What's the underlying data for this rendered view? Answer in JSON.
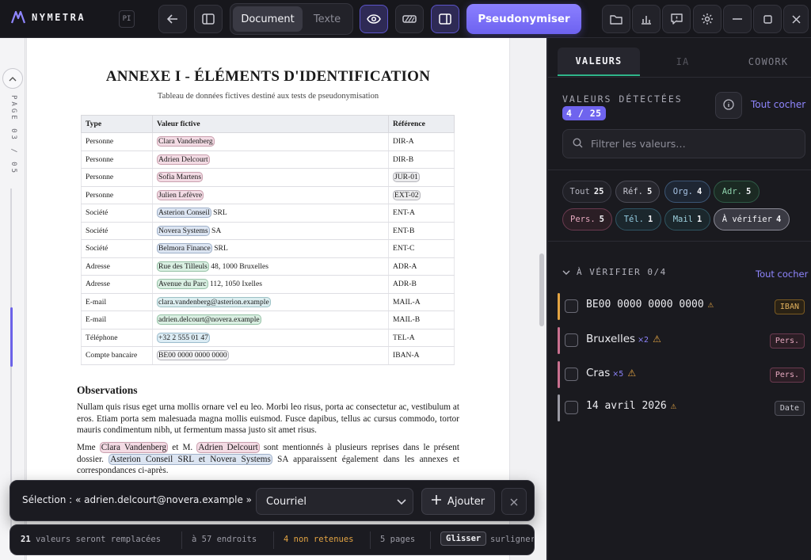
{
  "app": {
    "name": "NYMETRA",
    "page_badge": "PI"
  },
  "toolbar": {
    "view_tabs": [
      "Document",
      "Texte"
    ],
    "active_view": "Document",
    "pseudonymize_label": "Pseudonymiser"
  },
  "gutter": {
    "page_label": "PAGE 03 / 05"
  },
  "document": {
    "title": "ANNEXE I - ÉLÉMENTS D'IDENTIFICATION",
    "subtitle": "Tableau de données fictives destiné aux tests de pseudonymisation",
    "columns": [
      "Type",
      "Valeur fictive",
      "Référence"
    ],
    "rows": [
      {
        "type": "Personne",
        "value": "Clara Vandenberg",
        "suffix": "",
        "value_kind": "pers",
        "ref": "DIR-A",
        "ref_kind": ""
      },
      {
        "type": "Personne",
        "value": "Adrien Delcourt",
        "suffix": "",
        "value_kind": "pers",
        "ref": "DIR-B",
        "ref_kind": ""
      },
      {
        "type": "Personne",
        "value": "Sofia Martens",
        "suffix": "",
        "value_kind": "pers",
        "ref": "JUR-01",
        "ref_kind": "ref"
      },
      {
        "type": "Personne",
        "value": "Julien Lefèvre",
        "suffix": "",
        "value_kind": "pers",
        "ref": "EXT-02",
        "ref_kind": "ref"
      },
      {
        "type": "Société",
        "value": "Asterion Conseil",
        "suffix": " SRL",
        "value_kind": "org",
        "ref": "ENT-A",
        "ref_kind": ""
      },
      {
        "type": "Société",
        "value": "Novera Systems",
        "suffix": " SA",
        "value_kind": "org",
        "ref": "ENT-B",
        "ref_kind": ""
      },
      {
        "type": "Société",
        "value": "Belmora Finance",
        "suffix": " SRL",
        "value_kind": "org",
        "ref": "ENT-C",
        "ref_kind": ""
      },
      {
        "type": "Adresse",
        "value": "Rue des Tilleuls",
        "suffix": " 48, 1000 Bruxelles",
        "value_kind": "adr",
        "ref": "ADR-A",
        "ref_kind": ""
      },
      {
        "type": "Adresse",
        "value": "Avenue du Parc",
        "suffix": " 112, 1050 Ixelles",
        "value_kind": "adr",
        "ref": "ADR-B",
        "ref_kind": ""
      },
      {
        "type": "E-mail",
        "value": "clara.vandenberg@asterion.example",
        "suffix": "",
        "value_kind": "mail",
        "ref": "MAIL-A",
        "ref_kind": ""
      },
      {
        "type": "E-mail",
        "value": "adrien.delcourt@novera.example",
        "suffix": "",
        "value_kind": "adr",
        "ref": "MAIL-B",
        "ref_kind": ""
      },
      {
        "type": "Téléphone",
        "value": "+32 2 555 01 47",
        "suffix": "",
        "value_kind": "tel",
        "ref": "TEL-A",
        "ref_kind": ""
      },
      {
        "type": "Compte bancaire",
        "value": "BE00 0000 0000 0000",
        "suffix": "",
        "value_kind": "iban",
        "ref": "IBAN-A",
        "ref_kind": ""
      }
    ],
    "observations_title": "Observations",
    "para1": "Nullam quis risus eget urna mollis ornare vel eu leo. Morbi leo risus, porta ac consectetur ac, vestibulum at eros. Etiam porta sem malesuada magna mollis euismod. Fusce dapibus, tellus ac cursus commodo, tortor mauris condimentum nibh, ut fermentum massa justo sit amet risus.",
    "para2": {
      "t1": "Mme ",
      "h1": "Clara Vandenberg",
      "t2": " et M. ",
      "h2": "Adrien Delcourt",
      "t3": " sont mentionnés à plusieurs reprises dans le présent dossier. ",
      "h3": "Asterion Conseil SRL et Novera Systems",
      "t4": " SA apparaissent également dans les annexes et correspondances ci-après."
    }
  },
  "selection_bar": {
    "text": "Sélection : « adrien.delcourt@novera.example »",
    "category": "Courriel",
    "add_label": "Ajouter"
  },
  "status": {
    "count": "21",
    "replaced_text": " valeurs seront remplacées",
    "places": "à 57 endroits",
    "not_kept": "4 non retenues",
    "pages": "5 pages",
    "key": "Glisser",
    "key_hint": "surligner"
  },
  "panel": {
    "tabs": [
      "VALEURS",
      "IA",
      "COWORK"
    ],
    "active_tab": "VALEURS",
    "detected_label": "VALEURS DÉTECTÉES",
    "detected_count": "4 / 25",
    "check_all": "Tout cocher",
    "filter_placeholder": "Filtrer les valeurs…",
    "chips": [
      {
        "label": "Tout",
        "count": "25",
        "kind": "all"
      },
      {
        "label": "Réf.",
        "count": "5",
        "kind": "ref"
      },
      {
        "label": "Org.",
        "count": "4",
        "kind": "org"
      },
      {
        "label": "Adr.",
        "count": "5",
        "kind": "adr"
      },
      {
        "label": "Pers.",
        "count": "5",
        "kind": "pers"
      },
      {
        "label": "Tél.",
        "count": "1",
        "kind": "tel"
      },
      {
        "label": "Mail",
        "count": "1",
        "kind": "mail"
      },
      {
        "label": "À vérifier",
        "count": "4",
        "kind": "check"
      }
    ],
    "section_title": "À VÉRIFIER 0/4",
    "section_check_all": "Tout cocher",
    "items": [
      {
        "value": "BE00 0000 0000 0000",
        "mult": "",
        "tag": "IBAN",
        "kind": "iban",
        "mono": true,
        "color": "#e3a443"
      },
      {
        "value": "Bruxelles",
        "mult": "×2",
        "tag": "Pers.",
        "kind": "pers",
        "mono": false,
        "color": "#c9708f"
      },
      {
        "value": "Cras",
        "mult": "×5",
        "tag": "Pers.",
        "kind": "pers",
        "mono": false,
        "color": "#c9708f"
      },
      {
        "value": "14 avril 2026",
        "mult": "",
        "tag": "Date",
        "kind": "date",
        "mono": true,
        "color": "#9a9aa4"
      }
    ]
  },
  "colors": {
    "accent": "#6f64ee",
    "tab_underline": "#2fb58a",
    "warning": "#e3a443"
  }
}
